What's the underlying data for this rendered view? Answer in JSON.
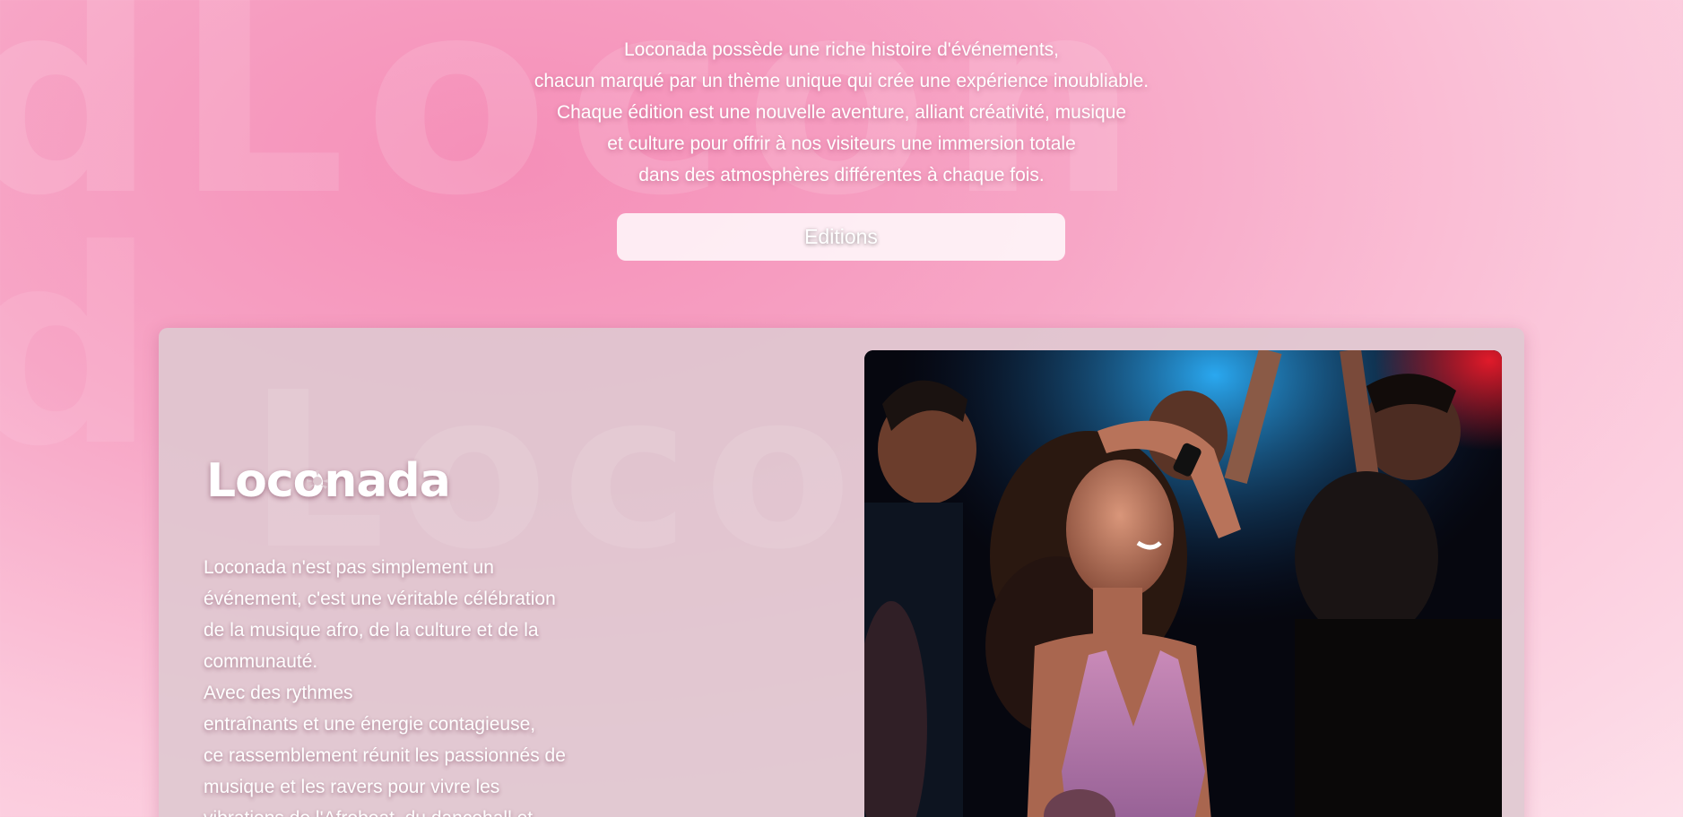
{
  "intro": {
    "lines": [
      "Loconada possède une riche histoire d'événements,",
      "chacun marqué par un thème unique qui crée une expérience inoubliable.",
      "Chaque édition est une nouvelle aventure, alliant créativité, musique",
      "et culture pour offrir à nos visiteurs une immersion totale",
      "dans des atmosphères différentes à chaque fois."
    ]
  },
  "editions_button": {
    "label": "Editions"
  },
  "about": {
    "logo_text": "Loconada",
    "lines": [
      "Loconada n'est pas simplement un",
      "événement, c'est une véritable célébration",
      "de la musique afro, de la culture et de la",
      "communauté.",
      "Avec des rythmes",
      "entraînants et une énergie contagieuse,",
      "ce rassemblement réunit les passionnés de",
      "musique et les ravers pour vivre les",
      "vibrations de l'Afrobeat, du dancehall et"
    ]
  },
  "photo": {
    "icon": "party-crowd-photo"
  },
  "colors": {
    "background_pink": "#f7a6c6",
    "card": "#dec8d0",
    "text": "#ffffff"
  }
}
